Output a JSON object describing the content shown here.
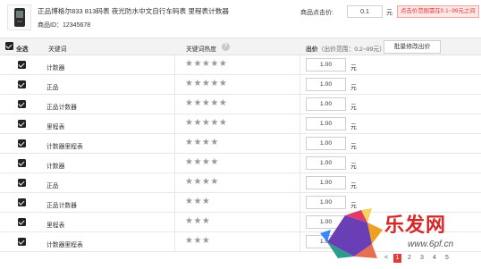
{
  "product": {
    "title": "正品博格尔833 813码表 夜光防水中文自行车码表 里程表计数器",
    "id_label": "商品ID：12345678",
    "price_label": "商品点击价:",
    "price_value": "0.1",
    "price_unit": "元",
    "price_warning": "点击价范围需在0.1~99元之间"
  },
  "table": {
    "select_all": "全选",
    "col_keyword": "关键词",
    "col_heat": "关键词热度",
    "col_bid": "出价",
    "bid_range": "（出价范围：0.2~99元）",
    "batch_button": "批量修改出价",
    "unit": "元",
    "rows": [
      {
        "keyword": "计数器",
        "stars": "★★★★★",
        "bid": "1.00"
      },
      {
        "keyword": "正品",
        "stars": "★★★★★",
        "bid": "1.00"
      },
      {
        "keyword": "正品计数器",
        "stars": "★★★★★",
        "bid": "1.00"
      },
      {
        "keyword": "里程表",
        "stars": "★★★★★",
        "bid": "1.00"
      },
      {
        "keyword": "计数器里程表",
        "stars": "★★★★",
        "bid": "1.00"
      },
      {
        "keyword": "计数器",
        "stars": "★★★★",
        "bid": "1.00"
      },
      {
        "keyword": "正品",
        "stars": "★★★★",
        "bid": "1.00"
      },
      {
        "keyword": "正品计数器",
        "stars": "★★★",
        "bid": "1.00"
      },
      {
        "keyword": "里程表",
        "stars": "★★★",
        "bid": "1.00"
      },
      {
        "keyword": "计数器里程表",
        "stars": "★★★",
        "bid": "1.00"
      }
    ]
  },
  "pagination": {
    "prev": "<",
    "pages": [
      "1",
      "2",
      "3",
      "4",
      "5"
    ],
    "current": "1"
  },
  "watermark": {
    "text": "乐发网",
    "url": "www.6pf.cn"
  },
  "colors": {
    "warning_red": "#e23b3b",
    "checkbox": "#222222",
    "star_grey": "#999999"
  }
}
